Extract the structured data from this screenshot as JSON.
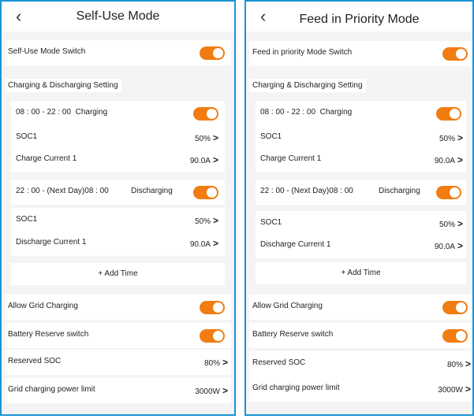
{
  "left": {
    "title": "Self-Use Mode",
    "mode_switch_label": "Self-Use Mode Switch",
    "section_label": "Charging & Discharging Setting",
    "slot1": {
      "time": "08 : 00 - 22 : 00",
      "type": "Charging",
      "soc_label": "SOC1",
      "soc_value": "50%",
      "current_label": "Charge Current 1",
      "current_value": "90.0A"
    },
    "slot2": {
      "time": "22 : 00 - (Next Day)08 : 00",
      "type": "Discharging",
      "soc_label": "SOC1",
      "soc_value": "50%",
      "current_label": "Discharge Current 1",
      "current_value": "90.0A"
    },
    "add_time_label": "+ Add Time",
    "allow_grid_label": "Allow Grid Charging",
    "battery_reserve_label": "Battery Reserve switch",
    "reserved_soc_label": "Reserved SOC",
    "reserved_soc_value": "80%",
    "grid_limit_label": "Grid charging power limit",
    "grid_limit_value": "3000W"
  },
  "right": {
    "title": "Feed in Priority Mode",
    "mode_switch_label": "Feed in priority Mode Switch",
    "section_label": "Charging & Discharging Setting",
    "slot1": {
      "time": "08 : 00 - 22 : 00",
      "type": "Charging",
      "soc_label": "SOC1",
      "soc_value": "50%",
      "current_label": "Charge Current 1",
      "current_value": "90.0A"
    },
    "slot2": {
      "time": "22 : 00 - (Next Day)08 : 00",
      "type": "Discharging",
      "soc_label": "SOC1",
      "soc_value": "50%",
      "current_label": "Discharge Current 1",
      "current_value": "90.0A"
    },
    "add_time_label": "+ Add Time",
    "allow_grid_label": "Allow Grid Charging",
    "battery_reserve_label": "Battery Reserve switch",
    "reserved_soc_label": "Reserved SOC",
    "reserved_soc_value": "80%",
    "grid_limit_label": "Grid charging power limit",
    "grid_limit_value": "3000W"
  },
  "icons": {
    "back": "chevron-left-icon",
    "arrow": "chevron-right-icon"
  },
  "colors": {
    "toggle_on": "#f07c12",
    "panel_border": "#1a93d6",
    "background": "#f4f4f4"
  }
}
